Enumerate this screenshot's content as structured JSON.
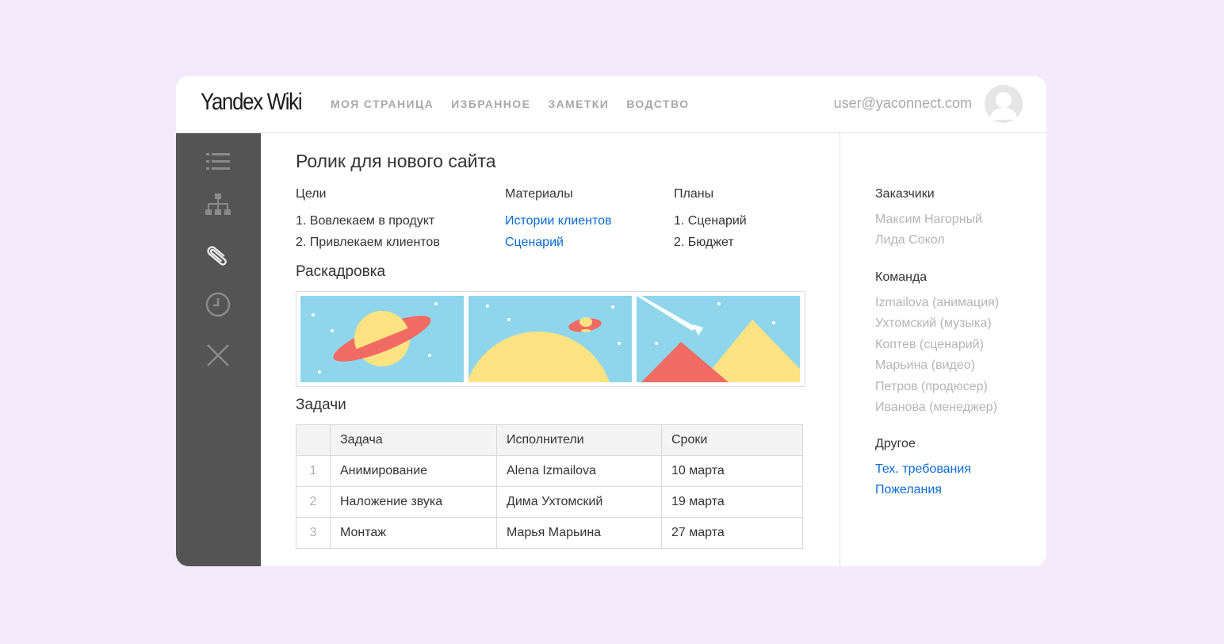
{
  "app": {
    "logo_part1": "Yandex",
    "logo_part2": " Wiki"
  },
  "nav": {
    "items": [
      "МОЯ СТРАНИЦА",
      "ИЗБРАННОЕ",
      "ЗАМЕТКИ",
      "ВОДСТВО"
    ]
  },
  "user": {
    "email": "user@yaconnect.com"
  },
  "sidebar": {
    "icons": [
      "list-icon",
      "sitemap-icon",
      "paperclip-icon",
      "clock-icon",
      "close-icon"
    ]
  },
  "page": {
    "title": "Ролик для нового сайта",
    "goals": {
      "heading": "Цели",
      "items": [
        "1. Вовлекаем в продукт",
        "2. Привлекаем клиентов"
      ]
    },
    "materials": {
      "heading": "Материалы",
      "links": [
        "Истории клиентов",
        "Сценарий"
      ]
    },
    "plans": {
      "heading": "Планы",
      "items": [
        "1. Сценарий",
        "2. Бюджет"
      ]
    },
    "storyboard_heading": "Раскадровка",
    "tasks_heading": "Задачи",
    "tasks_table": {
      "headers": [
        "",
        "Задача",
        "Исполнители",
        "Сроки"
      ],
      "rows": [
        [
          "1",
          "Анимирование",
          "Alena Izmailova",
          "10 марта"
        ],
        [
          "2",
          "Наложение звука",
          "Дима Ухтомский",
          "19 марта"
        ],
        [
          "3",
          "Монтаж",
          "Марья Марьина",
          "27 марта"
        ]
      ]
    }
  },
  "right_panel": {
    "customers": {
      "heading": "Заказчики",
      "items": [
        "Максим Нагорный",
        "Лида Сокол"
      ]
    },
    "team": {
      "heading": "Команда",
      "items": [
        "Izmailova (анимация)",
        "Ухтомский (музыка)",
        "Коптев (сценарий)",
        "Марьина (видео)",
        "Петров (продюсер)",
        "Иванова (менеджер)"
      ]
    },
    "other": {
      "heading": "Другое",
      "links": [
        "Тех. требования",
        "Пожелания"
      ]
    }
  },
  "colors": {
    "background": "#f3ebfc",
    "sidebar": "#545454",
    "link": "#0a6ad4",
    "muted_text": "#b5b5b5",
    "sky": "#8fd6ec",
    "planet_yellow": "#fde382",
    "planet_ring": "#f26b63"
  }
}
